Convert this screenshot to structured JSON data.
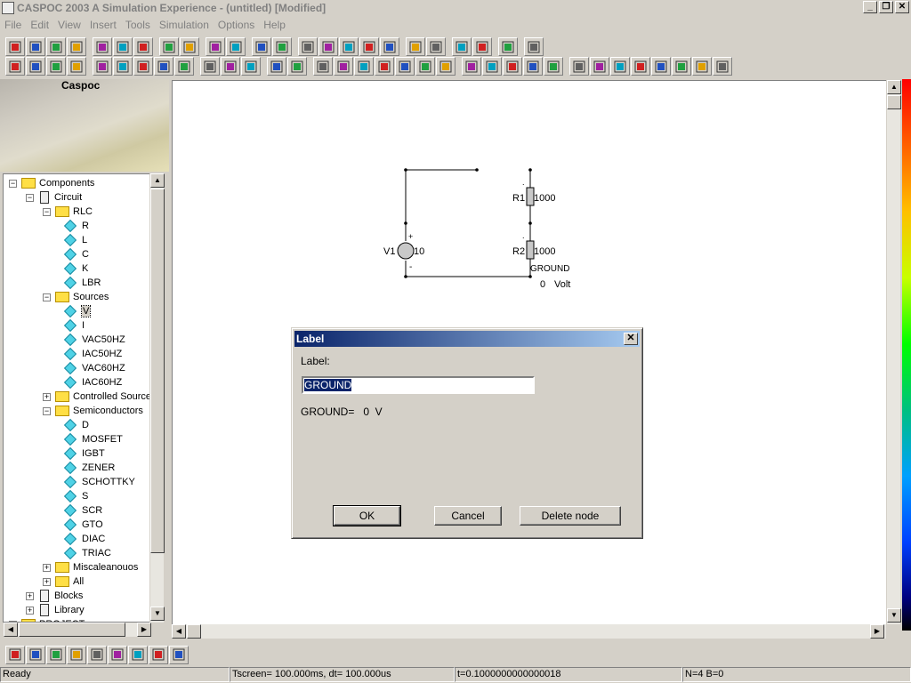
{
  "window": {
    "title": "CASPOC 2003 A Simulation Experience - (untitled) [Modified]",
    "min": "_",
    "restore": "❐",
    "close": "✕"
  },
  "menu": [
    "File",
    "Edit",
    "View",
    "Insert",
    "Tools",
    "Simulation",
    "Options",
    "Help"
  ],
  "side": {
    "brand": "Caspoc"
  },
  "tree": [
    {
      "label": "Components",
      "level": 0,
      "kind": "folder",
      "exp": "−"
    },
    {
      "label": "Circuit",
      "level": 1,
      "kind": "chip",
      "exp": "−"
    },
    {
      "label": "RLC",
      "level": 2,
      "kind": "folder",
      "exp": "−"
    },
    {
      "label": "R",
      "level": 3,
      "kind": "item"
    },
    {
      "label": "L",
      "level": 3,
      "kind": "item"
    },
    {
      "label": "C",
      "level": 3,
      "kind": "item"
    },
    {
      "label": "K",
      "level": 3,
      "kind": "item"
    },
    {
      "label": "LBR",
      "level": 3,
      "kind": "item"
    },
    {
      "label": "Sources",
      "level": 2,
      "kind": "folder",
      "exp": "−"
    },
    {
      "label": "V",
      "level": 3,
      "kind": "item",
      "selected": true
    },
    {
      "label": "I",
      "level": 3,
      "kind": "item"
    },
    {
      "label": "VAC50HZ",
      "level": 3,
      "kind": "item"
    },
    {
      "label": "IAC50HZ",
      "level": 3,
      "kind": "item"
    },
    {
      "label": "VAC60HZ",
      "level": 3,
      "kind": "item"
    },
    {
      "label": "IAC60HZ",
      "level": 3,
      "kind": "item"
    },
    {
      "label": "Controlled Source",
      "level": 2,
      "kind": "folder",
      "exp": "+"
    },
    {
      "label": "Semiconductors",
      "level": 2,
      "kind": "folder",
      "exp": "−"
    },
    {
      "label": "D",
      "level": 3,
      "kind": "item"
    },
    {
      "label": "MOSFET",
      "level": 3,
      "kind": "item"
    },
    {
      "label": "IGBT",
      "level": 3,
      "kind": "item"
    },
    {
      "label": "ZENER",
      "level": 3,
      "kind": "item"
    },
    {
      "label": "SCHOTTKY",
      "level": 3,
      "kind": "item"
    },
    {
      "label": "S",
      "level": 3,
      "kind": "item"
    },
    {
      "label": "SCR",
      "level": 3,
      "kind": "item"
    },
    {
      "label": "GTO",
      "level": 3,
      "kind": "item"
    },
    {
      "label": "DIAC",
      "level": 3,
      "kind": "item"
    },
    {
      "label": "TRIAC",
      "level": 3,
      "kind": "item"
    },
    {
      "label": "Miscaleanouos",
      "level": 2,
      "kind": "folder",
      "exp": "+"
    },
    {
      "label": "All",
      "level": 2,
      "kind": "folder",
      "exp": "+"
    },
    {
      "label": "Blocks",
      "level": 1,
      "kind": "chip",
      "exp": "+"
    },
    {
      "label": "Library",
      "level": 1,
      "kind": "chip",
      "exp": "+"
    },
    {
      "label": "PROJECT",
      "level": 0,
      "kind": "folder",
      "exp": "+"
    }
  ],
  "toolbar1": [
    "new-icon",
    "open-icon",
    "save-icon",
    "print-icon",
    "|",
    "cut-icon",
    "copy-icon",
    "paste-icon",
    "|",
    "undo-icon",
    "redo-icon",
    "|",
    "run-icon",
    "pause-icon",
    "|",
    "text-icon",
    "line-icon",
    "|",
    "hand-icon",
    "measure-icon",
    "list-icon",
    "list2-icon",
    "list3-icon",
    "|",
    "arrow-in-icon",
    "arrow-c-icon",
    "|",
    "export-icon",
    "import-icon",
    "|",
    "connect-icon",
    "|",
    "help-icon"
  ],
  "toolbar2": [
    "zoom100-icon",
    "zoom-fit-icon",
    "zoom-width-icon",
    "zoom-height-icon",
    "|",
    "resistor-icon",
    "capacitor-icon",
    "switch-icon",
    "block-icon",
    "probe-icon",
    "|",
    "globe1-icon",
    "globe2-icon",
    "globe3-icon",
    "|",
    "pen-icon",
    "text-abc-icon",
    "|",
    "scope-icon",
    "cross-icon",
    "arrow-r1-icon",
    "arrow-r2-icon",
    "node-icon",
    "number-icon",
    "wand-icon",
    "|",
    "plus-icon",
    "grid-icon",
    "clock-icon",
    "bucket-icon",
    "gauge-icon",
    "|",
    "move-icon",
    "fire-icon",
    "tractor-icon",
    "sort-icon",
    "chip1-icon",
    "chip2-icon",
    "chip3-icon",
    "table-icon"
  ],
  "bottom_toolbar": [
    "stack-icon",
    "tree-icon",
    "chip-icon",
    "refresh-icon",
    "window1-icon",
    "window2-icon",
    "image-icon",
    "folder-icon",
    "draw-icon"
  ],
  "circuit": {
    "v1_name": "V1",
    "v1_value": "10",
    "plus": "+",
    "minus": "-",
    "r1_name": "R1",
    "r1_value": "1000",
    "r2_name": "R2",
    "r2_value": "1000",
    "dot": ".",
    "ground_label": "GROUND",
    "ground_value": "0",
    "ground_unit": "Volt"
  },
  "dialog": {
    "title": "Label",
    "close": "✕",
    "label_caption": "Label:",
    "input_value": "GROUND",
    "info": "GROUND=   0  V",
    "ok": "OK",
    "cancel": "Cancel",
    "delete": "Delete node"
  },
  "status": {
    "ready": "Ready",
    "tscreen": "Tscreen= 100.000ms, dt= 100.000us",
    "time": "t=0.1000000000000018",
    "nodes": "N=4 B=0"
  },
  "scroll": {
    "up": "▲",
    "down": "▼",
    "left": "◀",
    "right": "▶"
  }
}
